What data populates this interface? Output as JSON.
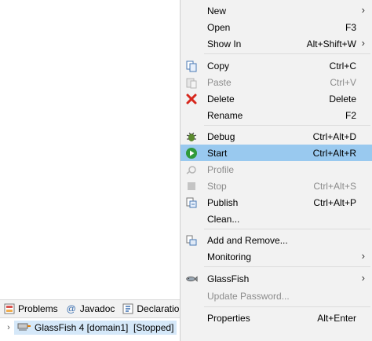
{
  "colors": {
    "menu_background": "#f2f2f2",
    "highlight": "#99c9ef",
    "disabled_text": "#8c8c8c",
    "selection": "#d5e8f9"
  },
  "views": {
    "tabs": [
      {
        "label": "Problems",
        "icon": "problems-icon"
      },
      {
        "label": "Javadoc",
        "icon": "at-icon"
      },
      {
        "label": "Declaration",
        "icon": "declaration-icon"
      }
    ],
    "server": {
      "label": "GlassFish 4 [domain1]  [Stopped]",
      "icon": "server-icon"
    }
  },
  "menu": {
    "new": {
      "label": "New",
      "icon": "none",
      "submenu": true
    },
    "open": {
      "label": "Open",
      "accel": "F3"
    },
    "show_in": {
      "label": "Show In",
      "accel": "Alt+Shift+W",
      "submenu": true
    },
    "copy": {
      "label": "Copy",
      "accel": "Ctrl+C",
      "icon": "copy-icon"
    },
    "paste": {
      "label": "Paste",
      "accel": "Ctrl+V",
      "icon": "paste-icon",
      "disabled": true
    },
    "delete": {
      "label": "Delete",
      "accel": "Delete",
      "icon": "delete-icon"
    },
    "rename": {
      "label": "Rename",
      "accel": "F2"
    },
    "debug": {
      "label": "Debug",
      "accel": "Ctrl+Alt+D",
      "icon": "debug-bug-icon"
    },
    "start": {
      "label": "Start",
      "accel": "Ctrl+Alt+R",
      "icon": "play-icon",
      "highlighted": true
    },
    "profile": {
      "label": "Profile",
      "icon": "profile-icon",
      "disabled": true
    },
    "stop": {
      "label": "Stop",
      "accel": "Ctrl+Alt+S",
      "icon": "stop-icon",
      "disabled": true
    },
    "publish": {
      "label": "Publish",
      "accel": "Ctrl+Alt+P",
      "icon": "publish-icon"
    },
    "clean": {
      "label": "Clean..."
    },
    "add_remove": {
      "label": "Add and Remove...",
      "icon": "add-remove-icon"
    },
    "monitoring": {
      "label": "Monitoring",
      "submenu": true
    },
    "glassfish": {
      "label": "GlassFish",
      "icon": "glassfish-icon",
      "submenu": true
    },
    "update_password": {
      "label": "Update Password...",
      "disabled": true
    },
    "properties": {
      "label": "Properties",
      "accel": "Alt+Enter"
    }
  }
}
